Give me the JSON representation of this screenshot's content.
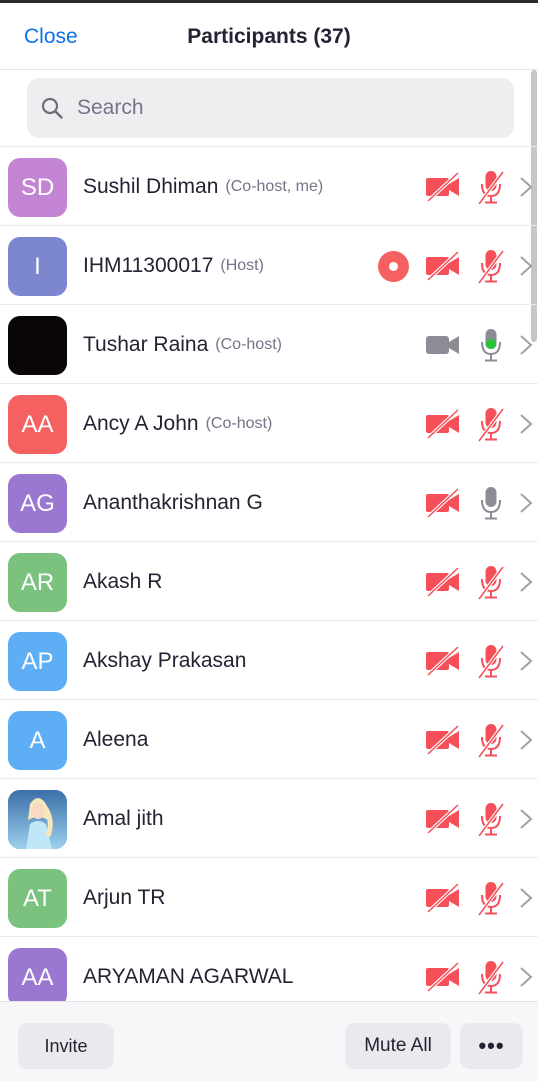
{
  "header": {
    "close_label": "Close",
    "title": "Participants (37)"
  },
  "search": {
    "placeholder": "Search",
    "value": ""
  },
  "colors": {
    "accent": "#0e71eb",
    "muted_red": "#f5505a",
    "live_green": "#2dbe3c",
    "gray_icon": "#8c8c96"
  },
  "participants": [
    {
      "initials": "SD",
      "name": "Sushil Dhiman",
      "role": "(Co-host, me)",
      "avatar_color": "#c385d3",
      "camera": "off",
      "mic": "muted"
    },
    {
      "initials": "I",
      "name": "IHM11300017",
      "role": "(Host)",
      "avatar_color": "#7c87cf",
      "camera": "off",
      "mic": "muted",
      "recording": true
    },
    {
      "initials": "",
      "name": "Tushar Raina",
      "role": "(Co-host)",
      "avatar_color": "#0a0506",
      "camera": "on",
      "mic": "active"
    },
    {
      "initials": "AA",
      "name": "Ancy A John",
      "role": "(Co-host)",
      "avatar_color": "#f56161",
      "camera": "off",
      "mic": "muted"
    },
    {
      "initials": "AG",
      "name": "Ananthakrishnan G",
      "role": "",
      "avatar_color": "#9a77d0",
      "camera": "off",
      "mic": "unmuted"
    },
    {
      "initials": "AR",
      "name": "Akash R",
      "role": "",
      "avatar_color": "#7ac27d",
      "camera": "off",
      "mic": "muted"
    },
    {
      "initials": "AP",
      "name": "Akshay Prakasan",
      "role": "",
      "avatar_color": "#5eaef5",
      "camera": "off",
      "mic": "muted"
    },
    {
      "initials": "A",
      "name": "Aleena",
      "role": "",
      "avatar_color": "#5eaef5",
      "camera": "off",
      "mic": "muted"
    },
    {
      "initials": "",
      "name": "Amal jith",
      "role": "",
      "avatar_color": "#4a8fc7",
      "camera": "off",
      "mic": "muted",
      "photo": true
    },
    {
      "initials": "AT",
      "name": "Arjun TR",
      "role": "",
      "avatar_color": "#7ac27d",
      "camera": "off",
      "mic": "muted"
    },
    {
      "initials": "AA",
      "name": "ARYAMAN AGARWAL",
      "role": "",
      "avatar_color": "#9a77d0",
      "camera": "off",
      "mic": "muted"
    }
  ],
  "footer": {
    "invite_label": "Invite",
    "mute_all_label": "Mute All",
    "more_label": "•••"
  }
}
